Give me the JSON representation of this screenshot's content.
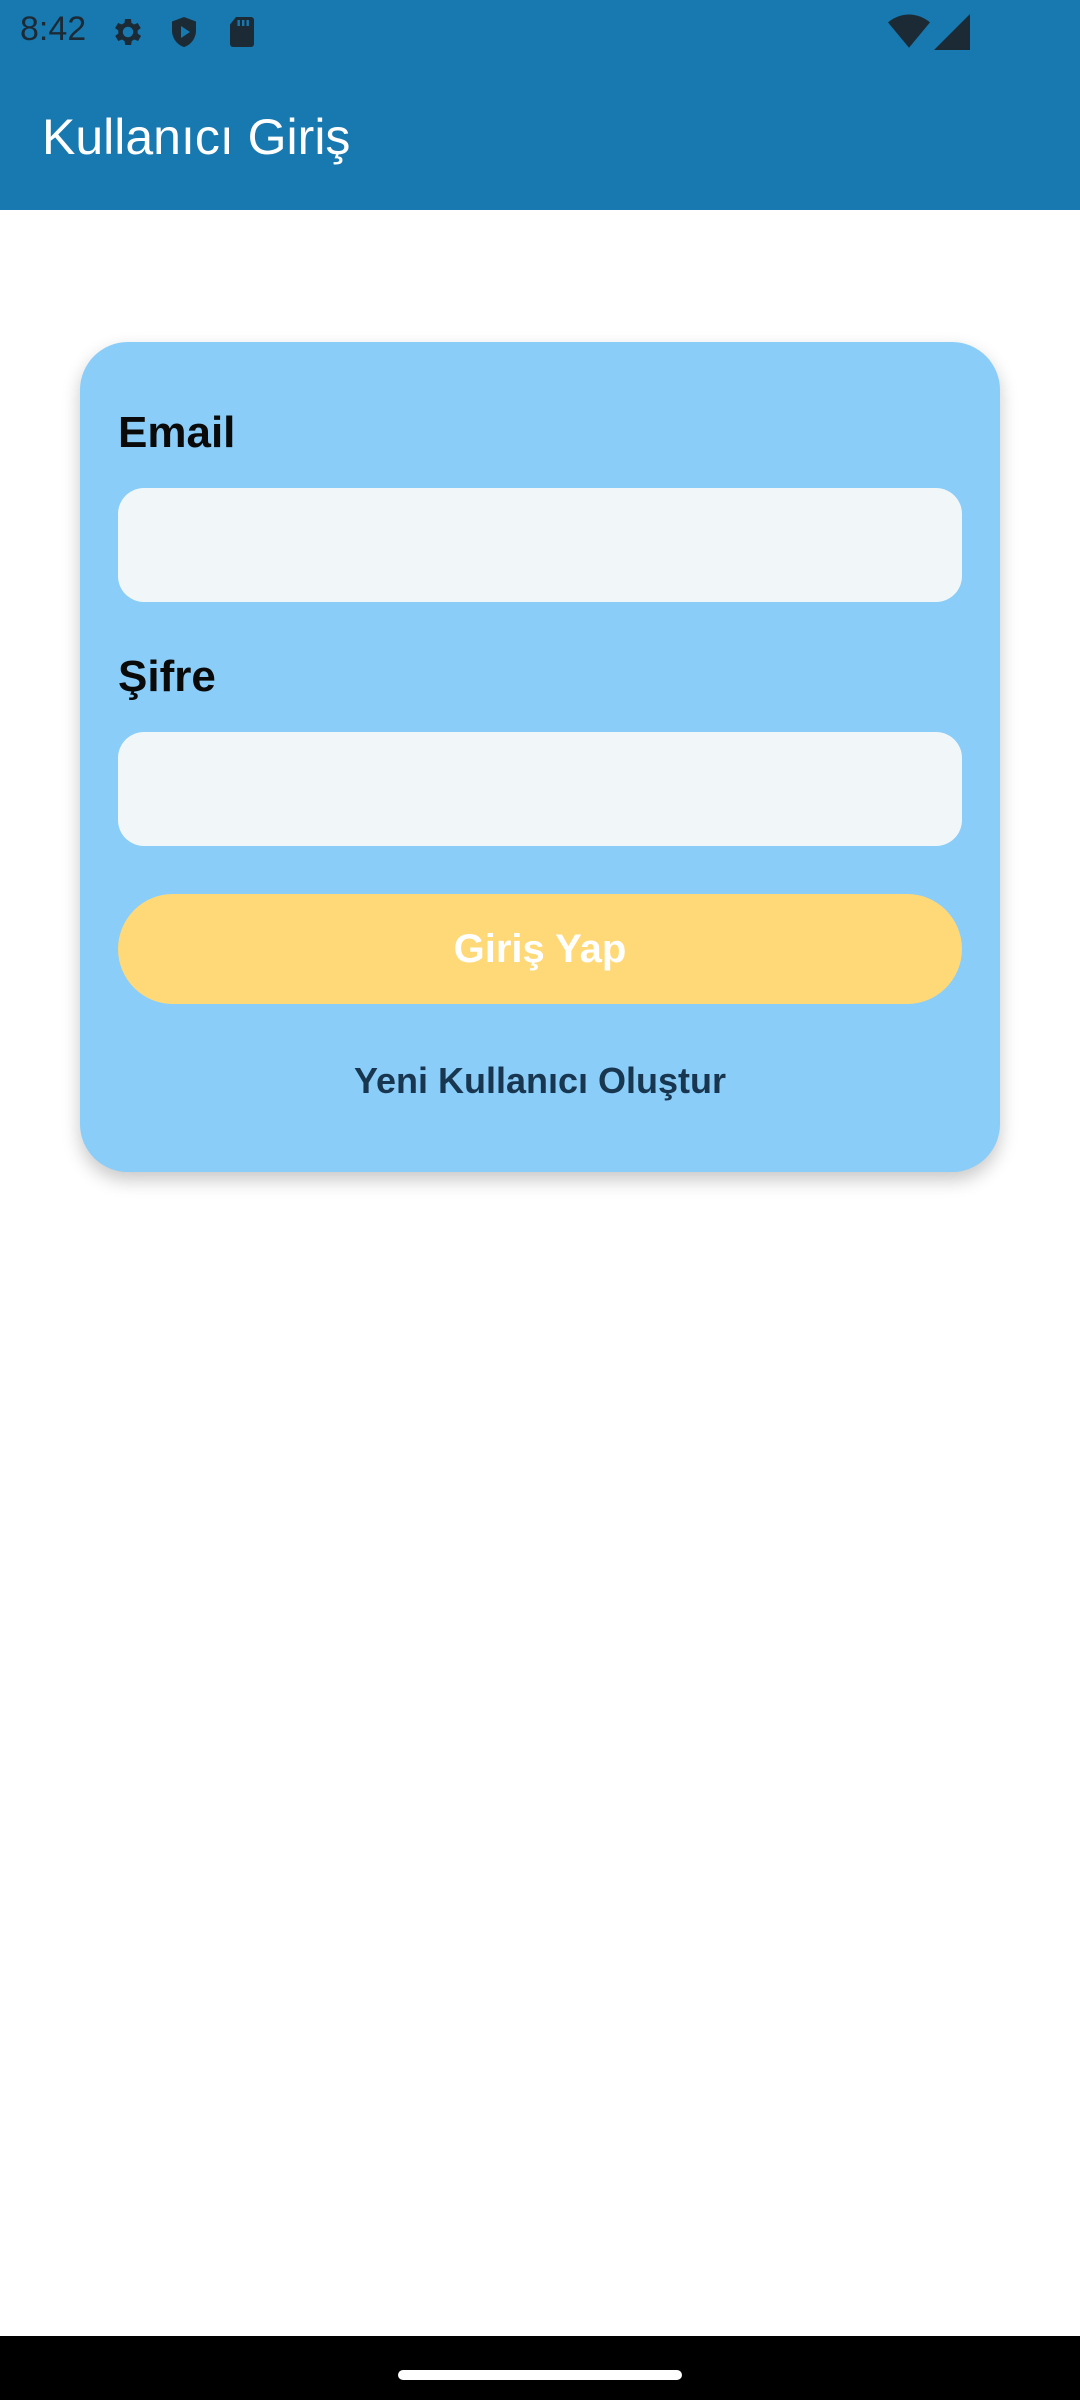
{
  "status_bar": {
    "time": "8:42",
    "icons": [
      "gear-icon",
      "shield-play-icon",
      "sd-card-icon",
      "wifi-icon",
      "signal-icon"
    ]
  },
  "app_bar": {
    "title": "Kullanıcı Giriş",
    "color": "#1779b0"
  },
  "form": {
    "email_label": "Email",
    "email_value": "",
    "password_label": "Şifre",
    "password_value": "",
    "login_button_label": "Giriş Yap",
    "register_link_label": "Yeni Kullanıcı Oluştur",
    "card_color": "#8acdf8",
    "button_color": "#ffd978"
  }
}
